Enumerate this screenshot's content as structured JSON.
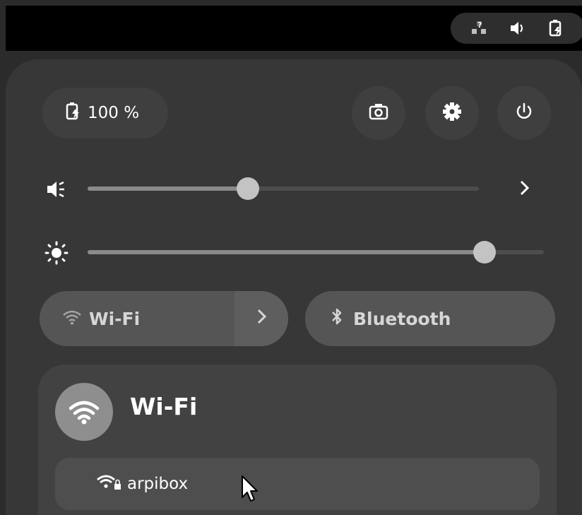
{
  "top_bar": {
    "status_icons": [
      "network-question-icon",
      "volume-icon",
      "battery-charging-icon"
    ]
  },
  "quick_settings": {
    "battery": {
      "label": "100 %",
      "icon": "battery-charging-icon"
    },
    "buttons": [
      "screenshot-icon",
      "settings-icon",
      "power-icon"
    ],
    "volume": {
      "icon": "volume-icon",
      "level": 0.41
    },
    "brightness": {
      "icon": "brightness-icon",
      "level": 0.87
    },
    "toggles": {
      "wifi": {
        "label": "Wi-Fi",
        "enabled": false
      },
      "bluetooth": {
        "label": "Bluetooth",
        "enabled": false
      }
    },
    "wifi_menu": {
      "title": "Wi-Fi",
      "networks": [
        {
          "name": "arpibox",
          "secured": true
        }
      ]
    }
  }
}
